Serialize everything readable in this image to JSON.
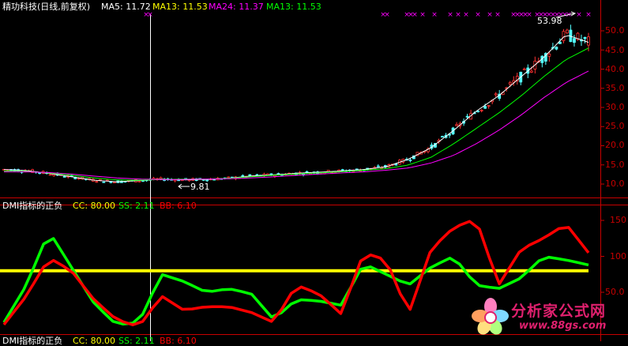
{
  "header": {
    "stock_title": "精功科技(日线,前复权)",
    "ma5": "MA5: 11.72",
    "ma13": "MA13: 11.53",
    "ma24": "MA24: 11.37",
    "ma13b": "MA13: 11.53"
  },
  "price_panel": {
    "high_label": "53.98",
    "low_label": "9.81",
    "y_ticks": [
      "50.0",
      "45.0",
      "40.0",
      "35.0",
      "30.0",
      "25.0",
      "20.0",
      "15.0",
      "10.0"
    ]
  },
  "dmi_panel": {
    "name": "DMI指标的正负",
    "cc": "CC: 80.00",
    "ss": "SS: 2.11",
    "bb": "BB: 6.10",
    "y_ticks": [
      "150",
      "100",
      "50.0"
    ]
  },
  "bottom_panel": {
    "name": "DMI指标的正负",
    "cc": "CC: 80.00",
    "ss": "SS: 2.11",
    "bb": "BB: 6.10"
  },
  "watermark": {
    "name": "分析家公式网",
    "url": "www.88gs.com"
  },
  "colors": {
    "ma5": "#ffffff",
    "ma13": "#ffff00",
    "ma24": "#ff00ff",
    "ma13b": "#00ff00",
    "cc": "#ffff00",
    "ss": "#00ff00",
    "bb": "#ff0000",
    "up_candle": "#ff3232",
    "down_candle": "#54ffff",
    "axis": "#c80000"
  },
  "chart_data": [
    {
      "type": "line",
      "title": "精功科技(日线,前复权)",
      "series": [
        {
          "name": "MA5",
          "values": [
            13.8,
            13.5,
            12.8,
            11.9,
            11.0,
            10.6,
            10.9,
            11.3,
            11.1,
            11.2,
            11.5,
            12.1,
            12.4,
            12.8,
            13.1,
            13.4,
            13.8,
            14.5,
            16.5,
            19.5,
            24.0,
            29.0,
            33.0,
            38.0,
            43.0,
            49.0,
            47.0
          ]
        },
        {
          "name": "MA13",
          "values": [
            13.4,
            13.3,
            12.9,
            12.3,
            11.6,
            11.1,
            11.0,
            11.2,
            11.3,
            11.3,
            11.5,
            11.9,
            12.3,
            12.6,
            12.9,
            13.2,
            13.6,
            14.0,
            15.0,
            17.0,
            20.5,
            24.5,
            28.5,
            33.0,
            38.0,
            42.5,
            45.5
          ]
        },
        {
          "name": "MA24",
          "values": [
            13.2,
            13.2,
            13.0,
            12.6,
            12.1,
            11.6,
            11.3,
            11.2,
            11.2,
            11.3,
            11.4,
            11.6,
            11.9,
            12.3,
            12.6,
            12.9,
            13.2,
            13.6,
            14.2,
            15.5,
            17.5,
            20.5,
            24.0,
            28.0,
            32.5,
            36.5,
            39.5
          ]
        }
      ],
      "annotations": [
        {
          "text": "53.98"
        },
        {
          "text": "9.81"
        }
      ],
      "ylim": [
        8,
        55
      ]
    },
    {
      "type": "line",
      "title": "DMI指标的正负",
      "series": [
        {
          "name": "CC",
          "values": [
            80,
            80,
            80,
            80,
            80,
            80,
            80,
            80,
            80,
            80,
            80,
            80,
            80,
            80,
            80,
            80,
            80,
            80,
            80,
            80,
            80,
            80,
            80,
            80,
            80,
            80,
            80
          ]
        },
        {
          "name": "SS",
          "values": [
            8,
            60,
            135,
            85,
            35,
            5,
            8,
            75,
            65,
            50,
            55,
            48,
            12,
            40,
            38,
            32,
            90,
            75,
            60,
            85,
            100,
            60,
            55,
            70,
            100,
            95,
            88
          ]
        },
        {
          "name": "BB",
          "values": [
            5,
            45,
            98,
            80,
            40,
            12,
            2,
            45,
            25,
            30,
            30,
            22,
            8,
            60,
            48,
            20,
            105,
            95,
            20,
            110,
            140,
            152,
            60,
            110,
            125,
            145,
            105
          ]
        }
      ],
      "ylim": [
        0,
        170
      ]
    }
  ]
}
